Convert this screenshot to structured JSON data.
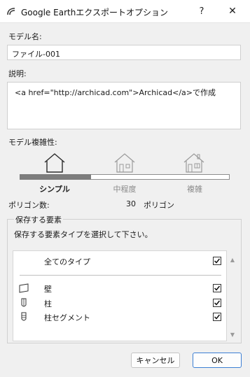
{
  "window": {
    "title": "Google Earthエクスポートオプション",
    "help": "?",
    "close": "✕"
  },
  "model_name": {
    "label": "モデル名:",
    "value": "ファイル-001"
  },
  "description": {
    "label": "説明:",
    "value": "<a href=\"http://archicad.com\">Archicad</a>で作成"
  },
  "complexity": {
    "label": "モデル複雑性:",
    "levels": [
      "シンプル",
      "中程度",
      "複雑"
    ],
    "selected_level": 0,
    "slider_fraction": 0.34
  },
  "polygon": {
    "label": "ポリゴン数:",
    "count": "30",
    "unit": "ポリゴン"
  },
  "elements": {
    "group_title": "保存する要素",
    "instruction": "保存する要素タイプを選択して下さい。",
    "all_types": {
      "label": "全てのタイプ",
      "checked": true
    },
    "items": [
      {
        "label": "壁",
        "icon": "wall-icon",
        "checked": true
      },
      {
        "label": "柱",
        "icon": "column-icon",
        "checked": true
      },
      {
        "label": "柱セグメント",
        "icon": "column-segment-icon",
        "checked": true
      }
    ]
  },
  "buttons": {
    "cancel": "キャンセル",
    "ok": "OK"
  },
  "colors": {
    "accent": "#3c7fd4",
    "slider_fill": "#7d7d7d"
  }
}
